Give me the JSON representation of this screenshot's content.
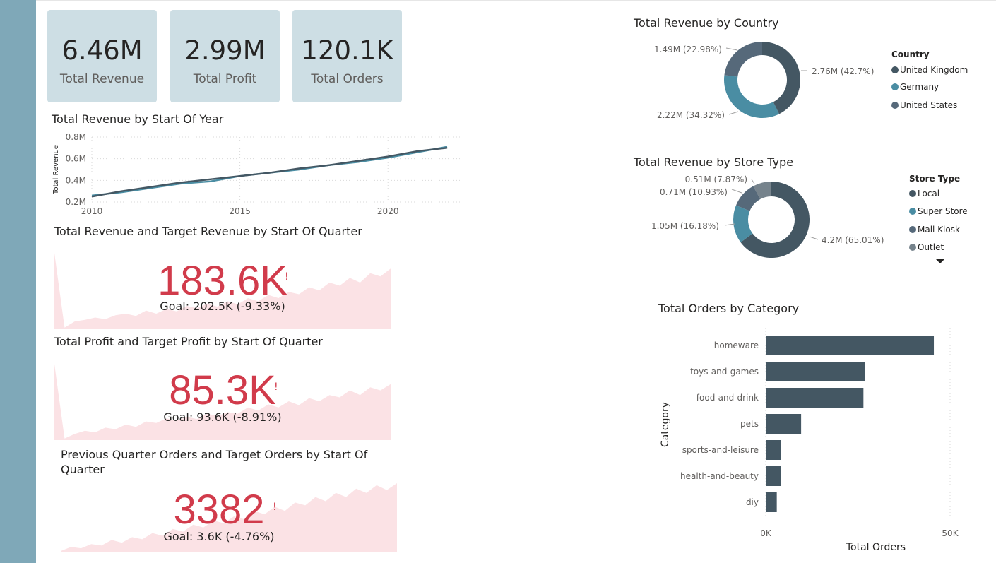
{
  "cards": [
    {
      "value": "6.46M",
      "label": "Total Revenue"
    },
    {
      "value": "2.99M",
      "label": "Total Profit"
    },
    {
      "value": "120.1K",
      "label": "Total Orders"
    }
  ],
  "visuals": {
    "revenue_by_year_title": "Total Revenue by Start Of Year",
    "kpi_revenue_title": "Total Revenue and Target Revenue by Start Of Quarter",
    "kpi_profit_title": "Total Profit and Target Profit by Start Of Quarter",
    "kpi_orders_title": "Previous Quarter Orders and Target Orders by Start Of Quarter",
    "country_title": "Total Revenue by Country",
    "store_title": "Total Revenue by Store Type",
    "category_title": "Total Orders by Category"
  },
  "kpis": {
    "revenue": {
      "value": "183.6K",
      "goal": "Goal: 202.5K (-9.33%)",
      "indicator": "!"
    },
    "profit": {
      "value": "85.3K",
      "goal": "Goal: 93.6K (-8.91%)",
      "indicator": "!"
    },
    "orders": {
      "value": "3382",
      "goal": "Goal: 3.6K (-4.76%)",
      "indicator": "!"
    }
  },
  "legends": {
    "country": {
      "title": "Country",
      "items": [
        "United Kingdom",
        "Germany",
        "United States"
      ]
    },
    "store": {
      "title": "Store Type",
      "items": [
        "Local",
        "Super Store",
        "Mall Kiosk",
        "Outlet"
      ]
    }
  },
  "colors": {
    "sidebar": "#7fa8b8",
    "card_bg": "#cddee4",
    "dark": "#445763",
    "teal": "#4a8da3",
    "slate": "#56697a",
    "grey": "#76838c",
    "kpi_red": "#d13b4b",
    "kpi_area": "#fbe2e5"
  },
  "chart_data": [
    {
      "type": "line",
      "title": "Total Revenue by Start Of Year",
      "xlabel": "",
      "ylabel": "Total Revenue",
      "xticks": [
        "2010",
        "2015",
        "2020"
      ],
      "yticks": [
        "0.2M",
        "0.4M",
        "0.6M",
        "0.8M"
      ],
      "ylim": [
        0.2,
        0.8
      ],
      "grid": true,
      "x": [
        2010,
        2011,
        2012,
        2013,
        2014,
        2015,
        2016,
        2017,
        2018,
        2019,
        2020,
        2021,
        2022
      ],
      "series": [
        {
          "values": [
            0.26,
            0.29,
            0.33,
            0.37,
            0.39,
            0.44,
            0.47,
            0.5,
            0.54,
            0.57,
            0.61,
            0.66,
            0.71
          ]
        },
        {
          "values": [
            0.25,
            0.3,
            0.34,
            0.38,
            0.41,
            0.44,
            0.47,
            0.51,
            0.54,
            0.58,
            0.62,
            0.67,
            0.7
          ]
        }
      ]
    },
    {
      "type": "pie",
      "title": "Total Revenue by Country",
      "legend_title": "Country",
      "categories": [
        "United Kingdom",
        "Germany",
        "United States"
      ],
      "values": [
        2.76,
        2.22,
        1.49
      ],
      "labels": [
        "2.76M (42.7%)",
        "2.22M (34.32%)",
        "1.49M (22.98%)"
      ],
      "colors": [
        "#445763",
        "#4a8da3",
        "#56697a"
      ],
      "legend_position": "right"
    },
    {
      "type": "pie",
      "title": "Total Revenue by Store Type",
      "legend_title": "Store Type",
      "categories": [
        "Local",
        "Super Store",
        "Mall Kiosk",
        "Outlet"
      ],
      "values": [
        4.2,
        1.05,
        0.71,
        0.51
      ],
      "labels": [
        "4.2M (65.01%)",
        "1.05M (16.18%)",
        "0.71M (10.93%)",
        "0.51M (7.87%)"
      ],
      "colors": [
        "#445763",
        "#4a8da3",
        "#56697a",
        "#76838c"
      ],
      "legend_position": "right"
    },
    {
      "type": "bar",
      "orientation": "horizontal",
      "title": "Total Orders by Category",
      "xlabel": "Total Orders",
      "ylabel": "Category",
      "categories": [
        "homeware",
        "toys-and-games",
        "food-and-drink",
        "pets",
        "sports-and-leisure",
        "health-and-beauty",
        "diy"
      ],
      "values": [
        45600,
        26900,
        26500,
        9600,
        4200,
        4100,
        3000
      ],
      "xticks": [
        "0K",
        "50K"
      ],
      "xlim": [
        0,
        50000
      ],
      "grid": true
    },
    {
      "type": "area",
      "title": "Total Revenue and Target Revenue by Start Of Quarter",
      "values": [
        0.98,
        0.02,
        0.1,
        0.12,
        0.15,
        0.13,
        0.18,
        0.2,
        0.17,
        0.24,
        0.2,
        0.26,
        0.23,
        0.3,
        0.27,
        0.33,
        0.29,
        0.36,
        0.32,
        0.4,
        0.36,
        0.44,
        0.4,
        0.48,
        0.45,
        0.54,
        0.5,
        0.6,
        0.56,
        0.66,
        0.6,
        0.72,
        0.68,
        0.78
      ]
    },
    {
      "type": "area",
      "title": "Total Profit and Target Profit by Start Of Quarter",
      "values": [
        0.98,
        0.02,
        0.08,
        0.12,
        0.1,
        0.16,
        0.14,
        0.2,
        0.17,
        0.24,
        0.22,
        0.28,
        0.25,
        0.3,
        0.27,
        0.34,
        0.31,
        0.36,
        0.34,
        0.42,
        0.38,
        0.46,
        0.42,
        0.5,
        0.45,
        0.54,
        0.5,
        0.58,
        0.55,
        0.64,
        0.58,
        0.68,
        0.64,
        0.72
      ]
    },
    {
      "type": "area",
      "title": "Previous Quarter Orders and Target Orders by Start Of Quarter",
      "values": [
        0.02,
        0.08,
        0.06,
        0.12,
        0.1,
        0.18,
        0.14,
        0.22,
        0.19,
        0.28,
        0.24,
        0.34,
        0.3,
        0.4,
        0.36,
        0.46,
        0.42,
        0.52,
        0.48,
        0.6,
        0.55,
        0.66,
        0.6,
        0.72,
        0.68,
        0.8,
        0.74,
        0.86,
        0.8,
        0.92,
        0.86,
        0.97,
        0.9,
        1.0
      ]
    }
  ]
}
